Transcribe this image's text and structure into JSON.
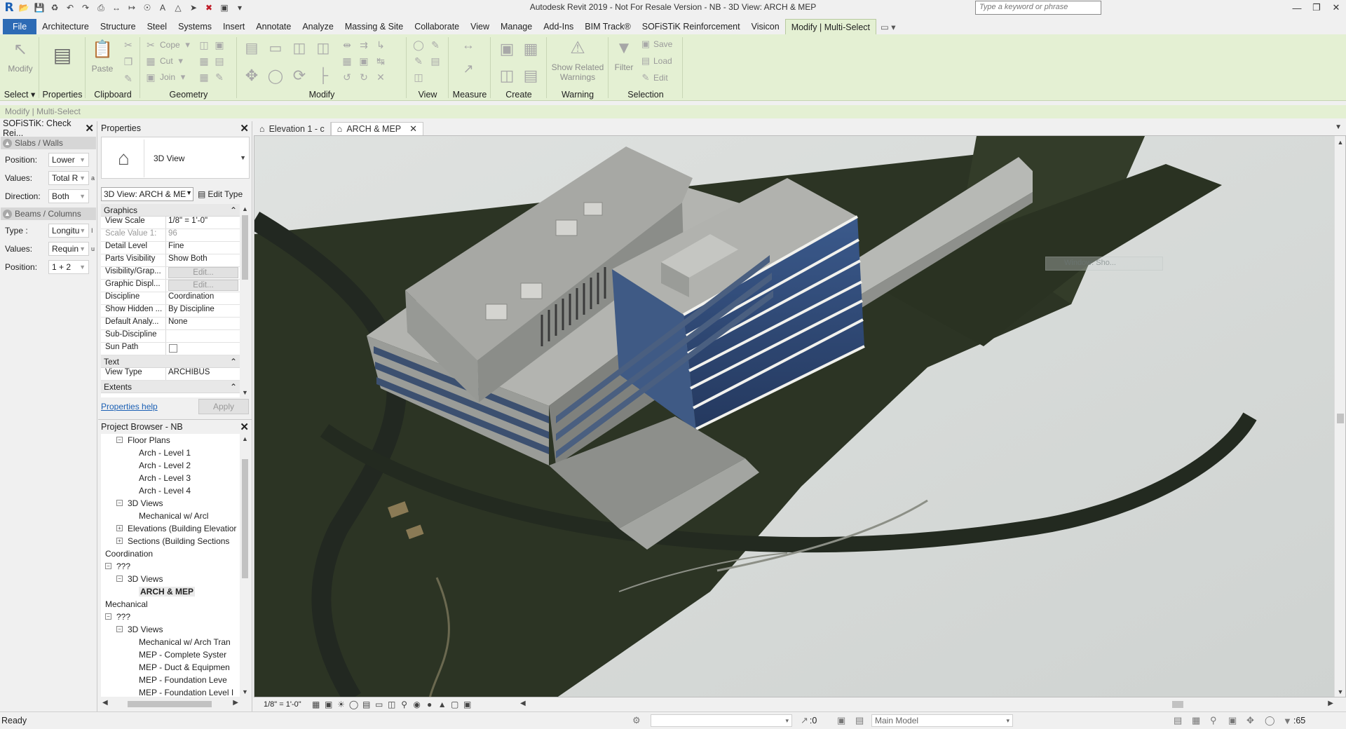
{
  "app": {
    "title": "Autodesk Revit 2019 - Not For Resale Version - NB - 3D View: ARCH & MEP",
    "search_placeholder": "Type a keyword or phrase"
  },
  "ribbon_tabs": [
    "Architecture",
    "Structure",
    "Steel",
    "Systems",
    "Insert",
    "Annotate",
    "Analyze",
    "Massing & Site",
    "Collaborate",
    "View",
    "Manage",
    "Add-Ins",
    "BIM Track®",
    "SOFiSTiK Reinforcement",
    "Visicon",
    "Modify | Multi-Select"
  ],
  "file_tab": "File",
  "ribbon": {
    "select": {
      "button": "Modify",
      "label": "Select"
    },
    "properties": {
      "button": "Properties",
      "label": "Properties"
    },
    "clipboard": {
      "paste": "Paste",
      "label": "Clipboard"
    },
    "geometry": {
      "cope": "Cope",
      "cut": "Cut",
      "join": "Join",
      "label": "Geometry"
    },
    "modify": {
      "label": "Modify"
    },
    "view": {
      "label": "View"
    },
    "measure": {
      "label": "Measure"
    },
    "create": {
      "label": "Create"
    },
    "warning": {
      "button_line1": "Show Related",
      "button_line2": "Warnings",
      "label": "Warning"
    },
    "selection": {
      "filter": "Filter",
      "save": "Save",
      "load": "Load",
      "edit": "Edit",
      "label": "Selection"
    }
  },
  "context_bar": "Modify | Multi-Select",
  "sofistik": {
    "title": "SOFiSTiK: Check Rei...",
    "sections": [
      {
        "title": "Slabs / Walls",
        "rows": [
          {
            "label": "Position:",
            "value": "Lower"
          },
          {
            "label": "Values:",
            "value": "Total R"
          },
          {
            "label": "Direction:",
            "value": "Both"
          }
        ]
      },
      {
        "title": "Beams / Columns",
        "rows": [
          {
            "label": "Type :",
            "value": "Longitu"
          },
          {
            "label": "Values:",
            "value": "Requin"
          },
          {
            "label": "Position:",
            "value": "1 + 2"
          }
        ]
      }
    ]
  },
  "properties": {
    "title": "Properties",
    "type_name": "3D View",
    "selector": "3D View: ARCH & ME",
    "edit_type": "Edit Type",
    "groups": [
      {
        "name": "Graphics",
        "rows": [
          {
            "key": "View Scale",
            "value": "1/8\" = 1'-0\""
          },
          {
            "key": "Scale Value    1:",
            "value": "96",
            "grey": true
          },
          {
            "key": "Detail Level",
            "value": "Fine"
          },
          {
            "key": "Parts Visibility",
            "value": "Show Both"
          },
          {
            "key": "Visibility/Grap...",
            "value": "Edit...",
            "button": true
          },
          {
            "key": "Graphic Displ...",
            "value": "Edit...",
            "button": true
          },
          {
            "key": "Discipline",
            "value": "Coordination"
          },
          {
            "key": "Show Hidden ...",
            "value": "By Discipline"
          },
          {
            "key": "Default Analy...",
            "value": "None"
          },
          {
            "key": "Sub-Discipline",
            "value": ""
          },
          {
            "key": "Sun Path",
            "value": "",
            "checkbox": true
          }
        ]
      },
      {
        "name": "Text",
        "rows": [
          {
            "key": "View Type",
            "value": "ARCHIBUS"
          }
        ]
      },
      {
        "name": "Extents",
        "rows": []
      }
    ],
    "help": "Properties help",
    "apply": "Apply"
  },
  "project_browser": {
    "title": "Project Browser - NB",
    "nodes": [
      {
        "label": "Floor Plans",
        "level": 1,
        "toggle": "−"
      },
      {
        "label": "Arch - Level 1",
        "level": 2
      },
      {
        "label": "Arch - Level 2",
        "level": 2
      },
      {
        "label": "Arch - Level 3",
        "level": 2
      },
      {
        "label": "Arch - Level 4",
        "level": 2
      },
      {
        "label": "3D Views",
        "level": 1,
        "toggle": "−"
      },
      {
        "label": "Mechanical w/ Arcl",
        "level": 2
      },
      {
        "label": "Elevations (Building Elevatior",
        "level": 1,
        "toggle": "+"
      },
      {
        "label": "Sections (Building Sections",
        "level": 1,
        "toggle": "+"
      },
      {
        "label": "Coordination",
        "level": -1
      },
      {
        "label": "???",
        "level": 0,
        "toggle": "−"
      },
      {
        "label": "3D Views",
        "level": 1,
        "toggle": "−"
      },
      {
        "label": "ARCH & MEP",
        "level": 2,
        "selected": true
      },
      {
        "label": "Mechanical",
        "level": -1
      },
      {
        "label": "???",
        "level": 0,
        "toggle": "−"
      },
      {
        "label": "3D Views",
        "level": 1,
        "toggle": "−"
      },
      {
        "label": "Mechanical w/ Arch Tran",
        "level": 2
      },
      {
        "label": "MEP - Complete Syster",
        "level": 2
      },
      {
        "label": "MEP - Duct & Equipmen",
        "level": 2
      },
      {
        "label": "MEP - Foundation Leve",
        "level": 2
      },
      {
        "label": "MEP - Foundation Level I",
        "level": 2
      }
    ]
  },
  "view_tabs": [
    {
      "label": "Elevation 1 - c",
      "active": false
    },
    {
      "label": "ARCH & MEP",
      "active": true
    }
  ],
  "viewport": {
    "ghost_label": "Window: Sho...",
    "colors": {
      "ground": "#2b3324",
      "sky": "#d9dcda",
      "roof": "#a9aaa6",
      "glass": "#2f4a78"
    }
  },
  "view_control": {
    "scale": "1/8\" = 1'-0\""
  },
  "status": {
    "ready": "Ready",
    "selection_count": ":0",
    "workset": "Main Model",
    "filter_count": ":65"
  }
}
